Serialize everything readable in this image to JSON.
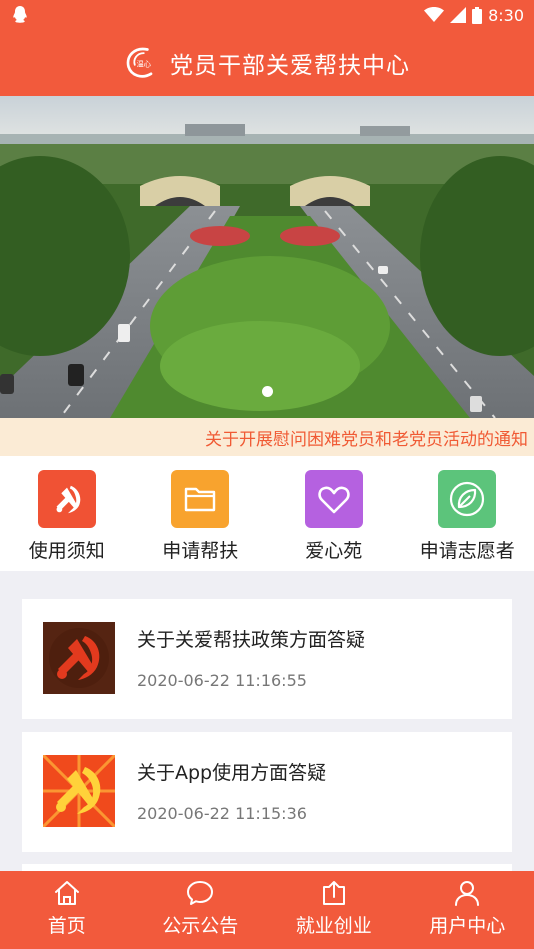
{
  "status_bar": {
    "time": "8:30",
    "icons": [
      "qq-icon",
      "wifi-icon",
      "signal-icon",
      "battery-icon"
    ]
  },
  "header": {
    "title": "党员干部关爱帮扶中心",
    "logo_text": "温心"
  },
  "banner": {
    "notice": "关于开展慰问困难党员和老党员活动的通知",
    "active_dot": 0,
    "dot_count": 1
  },
  "menu": [
    {
      "label": "使用须知",
      "icon": "party-emblem-icon",
      "color": "#f05234"
    },
    {
      "label": "申请帮扶",
      "icon": "folder-icon",
      "color": "#f8a32e"
    },
    {
      "label": "爱心苑",
      "icon": "heart-icon",
      "color": "#b561e0"
    },
    {
      "label": "申请志愿者",
      "icon": "leaf-icon",
      "color": "#5cc47b"
    }
  ],
  "articles": [
    {
      "title": "关于关爱帮扶政策方面答疑",
      "time": "2020-06-22 11:16:55"
    },
    {
      "title": "关于App使用方面答疑",
      "time": "2020-06-22 11:15:36"
    }
  ],
  "tabs": [
    {
      "label": "首页",
      "icon": "home-icon"
    },
    {
      "label": "公示公告",
      "icon": "chat-bubble-icon"
    },
    {
      "label": "就业创业",
      "icon": "upload-icon"
    },
    {
      "label": "用户中心",
      "icon": "user-icon"
    }
  ],
  "colors": {
    "primary": "#f25a3c",
    "notice_bg": "#fbebd5",
    "notice_text": "#f05a34"
  }
}
